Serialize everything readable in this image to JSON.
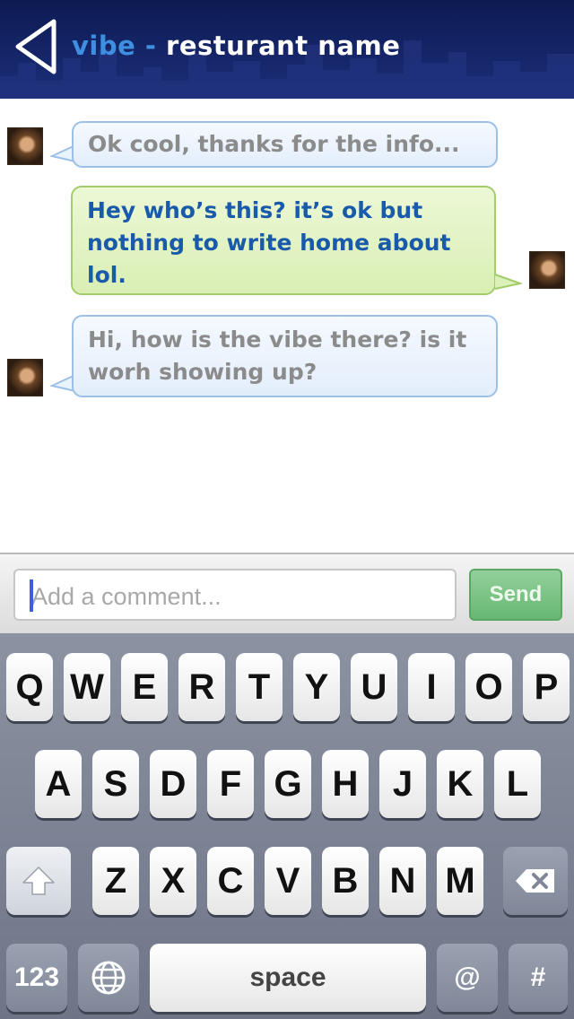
{
  "header": {
    "brand": "vibe",
    "separator": "-",
    "venue": "resturant name"
  },
  "messages": [
    {
      "side": "left",
      "text": "Ok cool, thanks for the info..."
    },
    {
      "side": "right",
      "text": "Hey who’s this? it’s ok but nothing to write home about lol."
    },
    {
      "side": "left",
      "text": "Hi, how is the vibe there? is it worh showing up?"
    }
  ],
  "comment": {
    "placeholder": "Add a comment...",
    "send_label": "Send"
  },
  "keyboard": {
    "row1": [
      "Q",
      "W",
      "E",
      "R",
      "T",
      "Y",
      "U",
      "I",
      "O",
      "P"
    ],
    "row2": [
      "A",
      "S",
      "D",
      "F",
      "G",
      "H",
      "J",
      "K",
      "L"
    ],
    "row3": [
      "Z",
      "X",
      "C",
      "V",
      "B",
      "N",
      "M"
    ],
    "numbers_label": "123",
    "space_label": "space",
    "at_label": "@",
    "hash_label": "#",
    "icons": {
      "back": "back-chevron-icon",
      "shift": "shift-arrow-icon",
      "delete": "backspace-icon",
      "globe": "globe-icon"
    }
  },
  "colors": {
    "header_bg": "#16266a",
    "brand": "#3f8fe0",
    "incoming_text": "#8b8b8b",
    "outgoing_text": "#1a5aaa",
    "send_button": "#67b772"
  }
}
